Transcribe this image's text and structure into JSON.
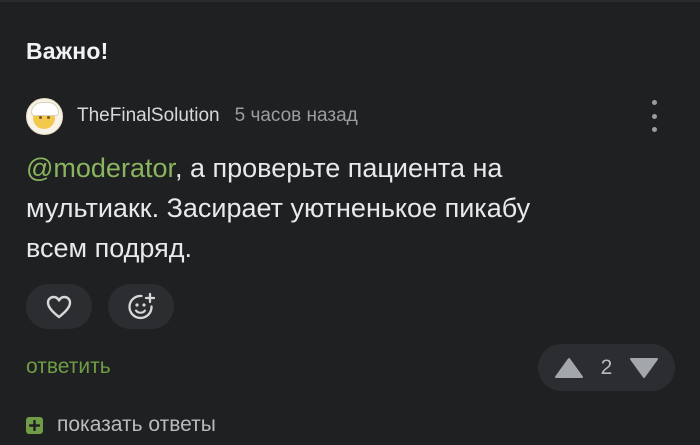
{
  "section": {
    "title": "Важно!"
  },
  "comment": {
    "author": "TheFinalSolution",
    "timestamp": "5 часов назад",
    "mention": "@moderator",
    "text": ", а проверьте пациента на мультиакк. Засирает уютненькое пикабу всем подряд.",
    "rating": "2"
  },
  "actions": {
    "reply_label": "ответить",
    "show_replies_label": "показать ответы"
  },
  "icons": {
    "like": "heart-icon",
    "reaction": "add-emoji-icon",
    "more": "vertical-dots-icon",
    "upvote": "triangle-up-icon",
    "downvote": "triangle-down-icon",
    "expand": "plus-icon"
  },
  "colors": {
    "background": "#1f2022",
    "accent_green": "#6f9c45",
    "mention_green": "#8ab45d",
    "text_primary": "#e8e9ea",
    "text_secondary": "#9a9da1",
    "button_bg": "#2c2d30"
  }
}
